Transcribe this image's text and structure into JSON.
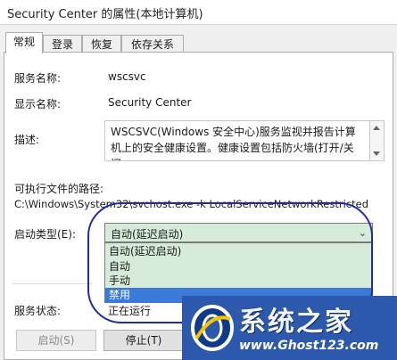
{
  "window": {
    "title": "Security Center 的属性(本地计算机)"
  },
  "tabs": [
    {
      "label": "常规",
      "active": true
    },
    {
      "label": "登录"
    },
    {
      "label": "恢复"
    },
    {
      "label": "依存关系"
    }
  ],
  "service": {
    "name_label": "服务名称:",
    "name_value": "wscsvc",
    "display_label": "显示名称:",
    "display_value": "Security Center",
    "desc_label": "描述:",
    "desc_value": "WSCSVC(Windows 安全中心)服务监视并报告计算机上的安全健康设置。健康设置包括防火墙(打开/关闭",
    "path_label": "可执行文件的路径:",
    "path_value": "C:\\Windows\\System32\\svchost.exe -k LocalServiceNetworkRestricted",
    "startup_label": "启动类型(E):",
    "startup_selected": "自动(延迟启动)",
    "startup_options": [
      "自动(延迟启动)",
      "自动",
      "手动",
      "禁用"
    ],
    "startup_highlighted_index": 3,
    "status_label": "服务状态:",
    "status_value": "正在运行"
  },
  "buttons": {
    "start": "启动(S)",
    "stop": "停止(T)"
  },
  "watermark": {
    "text": "系统之家",
    "url": "www.Ghost123.com"
  },
  "colors": {
    "selected_option_bg": "#3b7ad8",
    "dropdown_bg": "#d7ecd8",
    "annotation_circle": "#1f2da0",
    "watermark_bg": "#2d59ad"
  }
}
